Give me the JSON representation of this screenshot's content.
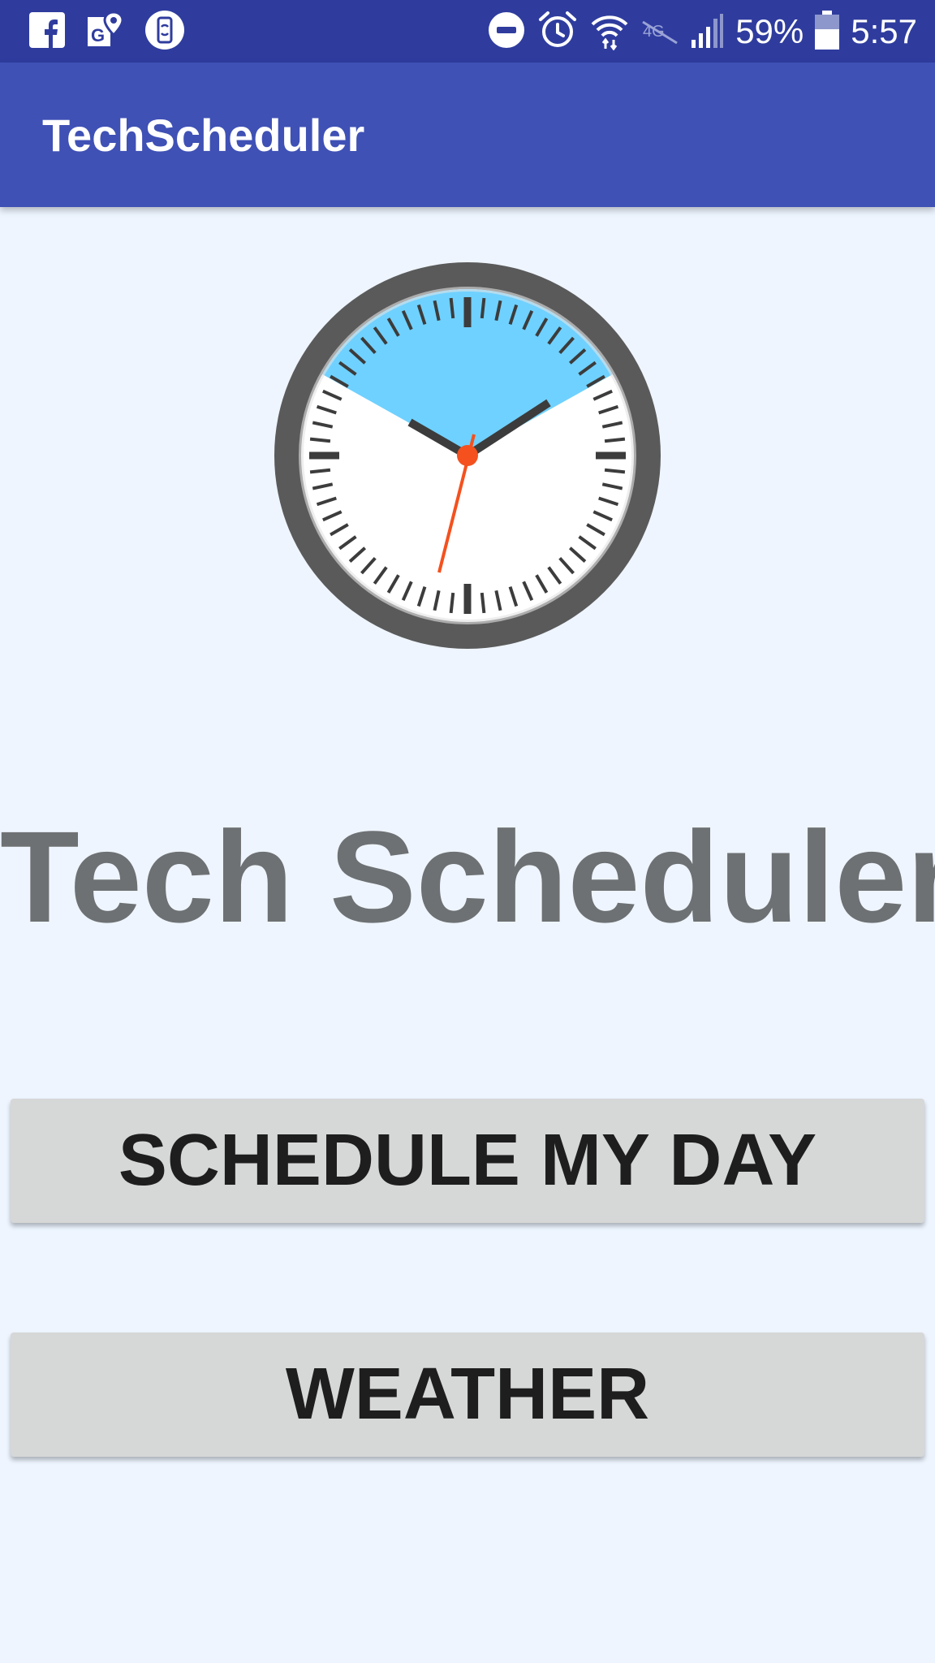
{
  "status_bar": {
    "battery_percent": "59%",
    "time": "5:57",
    "battery_level": 0.59,
    "left_icons": [
      "facebook-icon",
      "maps-icon",
      "phone-sync-icon"
    ],
    "right_icons": [
      "do-not-disturb-icon",
      "alarm-icon",
      "wifi-icon",
      "lte-off-icon",
      "signal-icon",
      "battery-icon"
    ],
    "background_color": "#2F3C9E"
  },
  "app_bar": {
    "title": "TechScheduler",
    "background_color": "#3F51B5"
  },
  "main": {
    "logo_icon": "clock-icon",
    "heading": "Tech Scheduler",
    "buttons": {
      "schedule_label": "SCHEDULE MY DAY",
      "weather_label": "WEATHER"
    }
  },
  "colors": {
    "background": "#EEF5FF",
    "clock_highlight": "#6FD1FF",
    "clock_second_hand": "#F4511E",
    "button_background": "#D6D7D7"
  }
}
